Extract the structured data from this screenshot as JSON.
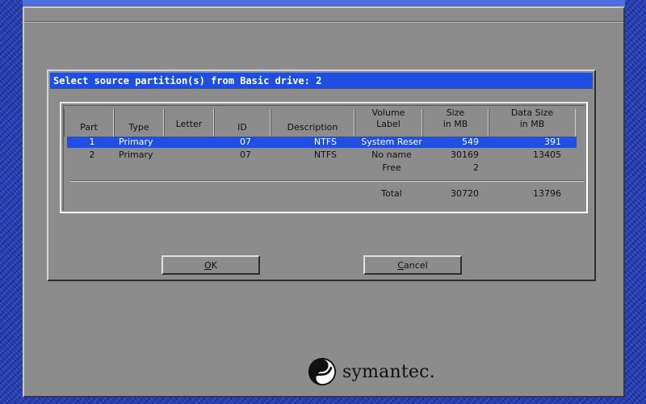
{
  "dialog": {
    "title": "Select source partition(s) from Basic drive: 2"
  },
  "table": {
    "headers": {
      "part": "Part",
      "type": "Type",
      "letter": "Letter",
      "id": "ID",
      "description": "Description",
      "volume_label_1": "Volume",
      "volume_label_2": "Label",
      "size_1": "Size",
      "size_2": "in MB",
      "data_size_1": "Data Size",
      "data_size_2": "in MB"
    },
    "rows": [
      {
        "part": "1",
        "type": "Primary",
        "letter": "",
        "id": "07",
        "description": "NTFS",
        "label": "System Reser",
        "size": "549",
        "data_size": "391",
        "selected": true
      },
      {
        "part": "2",
        "type": "Primary",
        "letter": "",
        "id": "07",
        "description": "NTFS",
        "label": "No name",
        "size": "30169",
        "data_size": "13405",
        "selected": false
      }
    ],
    "free": {
      "label": "Free",
      "size": "2"
    },
    "total": {
      "label": "Total",
      "size": "30720",
      "data_size": "13796"
    }
  },
  "buttons": {
    "ok_accel": "O",
    "ok_rest": "K",
    "cancel_accel": "C",
    "cancel_rest": "ancel"
  },
  "logo": {
    "text": "symantec."
  },
  "colors": {
    "titlebar": "#1f4fe0",
    "selection": "#1f4fe0",
    "dialog_bg": "#8c8c8c",
    "desktop": "#2640b8"
  }
}
